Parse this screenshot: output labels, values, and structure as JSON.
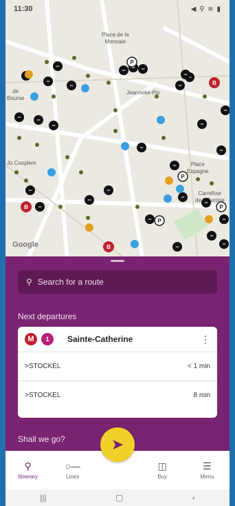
{
  "status": {
    "time": "11:30",
    "icons": "◀ ⚲ ≋ ▮"
  },
  "map": {
    "labels": [
      "Place de la\nMonnaie",
      "Jeanneke-Pis",
      "de\nBourse",
      "Jo Cooplem",
      "Place\nEspagne",
      "Carrefour\nde L'Europe"
    ],
    "google": "Google"
  },
  "search": {
    "icon": "search-icon",
    "placeholder": "Search for a route"
  },
  "sections": {
    "next": "Next departures",
    "shall": "Shall we go?"
  },
  "stop": {
    "metro_badge": "M",
    "line_badge": "1",
    "name": "Sainte-Catherine",
    "departures": [
      {
        "destination": ">STOCKEL",
        "time": "< 1 min"
      },
      {
        "destination": ">STOCKEL",
        "time": "8 min"
      }
    ]
  },
  "nav": {
    "items": [
      {
        "label": "Itinerary",
        "icon": "pin-icon"
      },
      {
        "label": "Lines",
        "icon": "lines-icon"
      },
      {
        "label": "Buy",
        "icon": "ticket-icon"
      },
      {
        "label": "Menu",
        "icon": "menu-icon"
      }
    ],
    "fab_icon": "rocket-icon"
  },
  "colors": {
    "brand": "#7a2370",
    "accent": "#f1d02a",
    "metro": "#c0202e",
    "line1": "#b8207c"
  }
}
